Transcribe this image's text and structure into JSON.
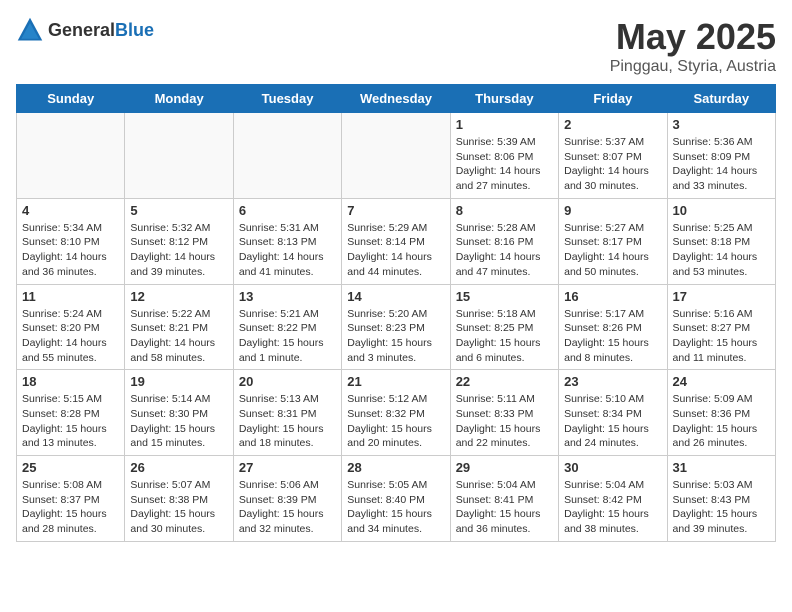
{
  "header": {
    "logo_general": "General",
    "logo_blue": "Blue",
    "title": "May 2025",
    "subtitle": "Pinggau, Styria, Austria"
  },
  "days_of_week": [
    "Sunday",
    "Monday",
    "Tuesday",
    "Wednesday",
    "Thursday",
    "Friday",
    "Saturday"
  ],
  "weeks": [
    [
      {
        "day": "",
        "info": ""
      },
      {
        "day": "",
        "info": ""
      },
      {
        "day": "",
        "info": ""
      },
      {
        "day": "",
        "info": ""
      },
      {
        "day": "1",
        "info": "Sunrise: 5:39 AM\nSunset: 8:06 PM\nDaylight: 14 hours\nand 27 minutes."
      },
      {
        "day": "2",
        "info": "Sunrise: 5:37 AM\nSunset: 8:07 PM\nDaylight: 14 hours\nand 30 minutes."
      },
      {
        "day": "3",
        "info": "Sunrise: 5:36 AM\nSunset: 8:09 PM\nDaylight: 14 hours\nand 33 minutes."
      }
    ],
    [
      {
        "day": "4",
        "info": "Sunrise: 5:34 AM\nSunset: 8:10 PM\nDaylight: 14 hours\nand 36 minutes."
      },
      {
        "day": "5",
        "info": "Sunrise: 5:32 AM\nSunset: 8:12 PM\nDaylight: 14 hours\nand 39 minutes."
      },
      {
        "day": "6",
        "info": "Sunrise: 5:31 AM\nSunset: 8:13 PM\nDaylight: 14 hours\nand 41 minutes."
      },
      {
        "day": "7",
        "info": "Sunrise: 5:29 AM\nSunset: 8:14 PM\nDaylight: 14 hours\nand 44 minutes."
      },
      {
        "day": "8",
        "info": "Sunrise: 5:28 AM\nSunset: 8:16 PM\nDaylight: 14 hours\nand 47 minutes."
      },
      {
        "day": "9",
        "info": "Sunrise: 5:27 AM\nSunset: 8:17 PM\nDaylight: 14 hours\nand 50 minutes."
      },
      {
        "day": "10",
        "info": "Sunrise: 5:25 AM\nSunset: 8:18 PM\nDaylight: 14 hours\nand 53 minutes."
      }
    ],
    [
      {
        "day": "11",
        "info": "Sunrise: 5:24 AM\nSunset: 8:20 PM\nDaylight: 14 hours\nand 55 minutes."
      },
      {
        "day": "12",
        "info": "Sunrise: 5:22 AM\nSunset: 8:21 PM\nDaylight: 14 hours\nand 58 minutes."
      },
      {
        "day": "13",
        "info": "Sunrise: 5:21 AM\nSunset: 8:22 PM\nDaylight: 15 hours\nand 1 minute."
      },
      {
        "day": "14",
        "info": "Sunrise: 5:20 AM\nSunset: 8:23 PM\nDaylight: 15 hours\nand 3 minutes."
      },
      {
        "day": "15",
        "info": "Sunrise: 5:18 AM\nSunset: 8:25 PM\nDaylight: 15 hours\nand 6 minutes."
      },
      {
        "day": "16",
        "info": "Sunrise: 5:17 AM\nSunset: 8:26 PM\nDaylight: 15 hours\nand 8 minutes."
      },
      {
        "day": "17",
        "info": "Sunrise: 5:16 AM\nSunset: 8:27 PM\nDaylight: 15 hours\nand 11 minutes."
      }
    ],
    [
      {
        "day": "18",
        "info": "Sunrise: 5:15 AM\nSunset: 8:28 PM\nDaylight: 15 hours\nand 13 minutes."
      },
      {
        "day": "19",
        "info": "Sunrise: 5:14 AM\nSunset: 8:30 PM\nDaylight: 15 hours\nand 15 minutes."
      },
      {
        "day": "20",
        "info": "Sunrise: 5:13 AM\nSunset: 8:31 PM\nDaylight: 15 hours\nand 18 minutes."
      },
      {
        "day": "21",
        "info": "Sunrise: 5:12 AM\nSunset: 8:32 PM\nDaylight: 15 hours\nand 20 minutes."
      },
      {
        "day": "22",
        "info": "Sunrise: 5:11 AM\nSunset: 8:33 PM\nDaylight: 15 hours\nand 22 minutes."
      },
      {
        "day": "23",
        "info": "Sunrise: 5:10 AM\nSunset: 8:34 PM\nDaylight: 15 hours\nand 24 minutes."
      },
      {
        "day": "24",
        "info": "Sunrise: 5:09 AM\nSunset: 8:36 PM\nDaylight: 15 hours\nand 26 minutes."
      }
    ],
    [
      {
        "day": "25",
        "info": "Sunrise: 5:08 AM\nSunset: 8:37 PM\nDaylight: 15 hours\nand 28 minutes."
      },
      {
        "day": "26",
        "info": "Sunrise: 5:07 AM\nSunset: 8:38 PM\nDaylight: 15 hours\nand 30 minutes."
      },
      {
        "day": "27",
        "info": "Sunrise: 5:06 AM\nSunset: 8:39 PM\nDaylight: 15 hours\nand 32 minutes."
      },
      {
        "day": "28",
        "info": "Sunrise: 5:05 AM\nSunset: 8:40 PM\nDaylight: 15 hours\nand 34 minutes."
      },
      {
        "day": "29",
        "info": "Sunrise: 5:04 AM\nSunset: 8:41 PM\nDaylight: 15 hours\nand 36 minutes."
      },
      {
        "day": "30",
        "info": "Sunrise: 5:04 AM\nSunset: 8:42 PM\nDaylight: 15 hours\nand 38 minutes."
      },
      {
        "day": "31",
        "info": "Sunrise: 5:03 AM\nSunset: 8:43 PM\nDaylight: 15 hours\nand 39 minutes."
      }
    ]
  ]
}
